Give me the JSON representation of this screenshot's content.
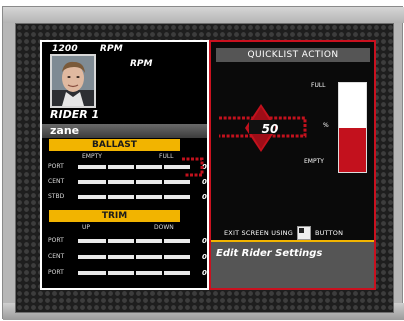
{
  "rpm": {
    "value": "1200",
    "unit": "RPM",
    "unit2": "RPM"
  },
  "rider": {
    "label": "RIDER 1",
    "name": "zane"
  },
  "ballast": {
    "title": "BALLAST",
    "empty_label": "EMPTY",
    "full_label": "FULL",
    "rows": [
      {
        "label": "PORT",
        "value": "0"
      },
      {
        "label": "CENT",
        "value": "0"
      },
      {
        "label": "STBD",
        "value": "0"
      }
    ]
  },
  "trim": {
    "title": "TRIM",
    "up_label": "UP",
    "down_label": "DOWN",
    "rows": [
      {
        "label": "PORT",
        "value": "0"
      },
      {
        "label": "CENT",
        "value": "0"
      },
      {
        "label": "PORT",
        "value": "0"
      }
    ]
  },
  "quicklist": {
    "title": "QUICKLIST ACTION",
    "full": "FULL",
    "percent": "%",
    "empty": "EMPTY",
    "dial_value": "50",
    "gauge_level_percent": 50,
    "exit_text_before": "EXIT SCREEN USING",
    "exit_text_after": "BUTTON",
    "edit_label": "Edit Rider Settings"
  },
  "colors": {
    "accent_red": "#c3111d",
    "accent_yellow": "#f2b400"
  }
}
